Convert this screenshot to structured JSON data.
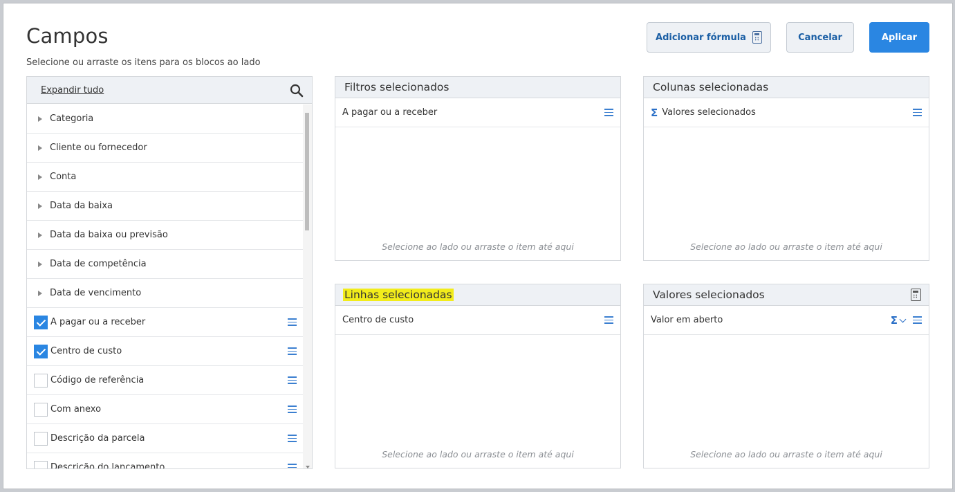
{
  "header": {
    "title": "Campos",
    "subtitle": "Selecione ou arraste os itens para os blocos ao lado",
    "formula_label": "Adicionar fórmula",
    "cancel_label": "Cancelar",
    "apply_label": "Aplicar"
  },
  "fields_panel": {
    "expand_label": "Expandir tudo",
    "groups": [
      {
        "label": "Categoria"
      },
      {
        "label": "Cliente ou fornecedor"
      },
      {
        "label": "Conta"
      },
      {
        "label": "Data da baixa"
      },
      {
        "label": "Data da baixa ou previsão"
      },
      {
        "label": "Data de competência"
      },
      {
        "label": "Data de vencimento"
      }
    ],
    "items": [
      {
        "label": "A pagar ou a receber",
        "checked": true
      },
      {
        "label": "Centro de custo",
        "checked": true
      },
      {
        "label": "Código de referência",
        "checked": false
      },
      {
        "label": "Com anexo",
        "checked": false
      },
      {
        "label": "Descrição da parcela",
        "checked": false
      },
      {
        "label": "Descrição do lançamento",
        "checked": false
      }
    ]
  },
  "boxes": {
    "filters": {
      "title": "Filtros selecionados",
      "item": "A pagar ou a receber",
      "hint": "Selecione ao lado ou arraste o item até aqui"
    },
    "columns": {
      "title": "Colunas selecionadas",
      "item": "Valores selecionados",
      "hint": "Selecione ao lado ou arraste o item até aqui"
    },
    "rows": {
      "title": "Linhas selecionadas",
      "item": "Centro de custo",
      "hint": "Selecione ao lado ou arraste o item até aqui"
    },
    "values": {
      "title": "Valores selecionados",
      "item": "Valor em aberto",
      "hint": "Selecione ao lado ou arraste o item até aqui"
    }
  },
  "icons": {
    "sigma": "Σ",
    "accent": "#2a86e2",
    "highlight": "#f2ec1b"
  }
}
